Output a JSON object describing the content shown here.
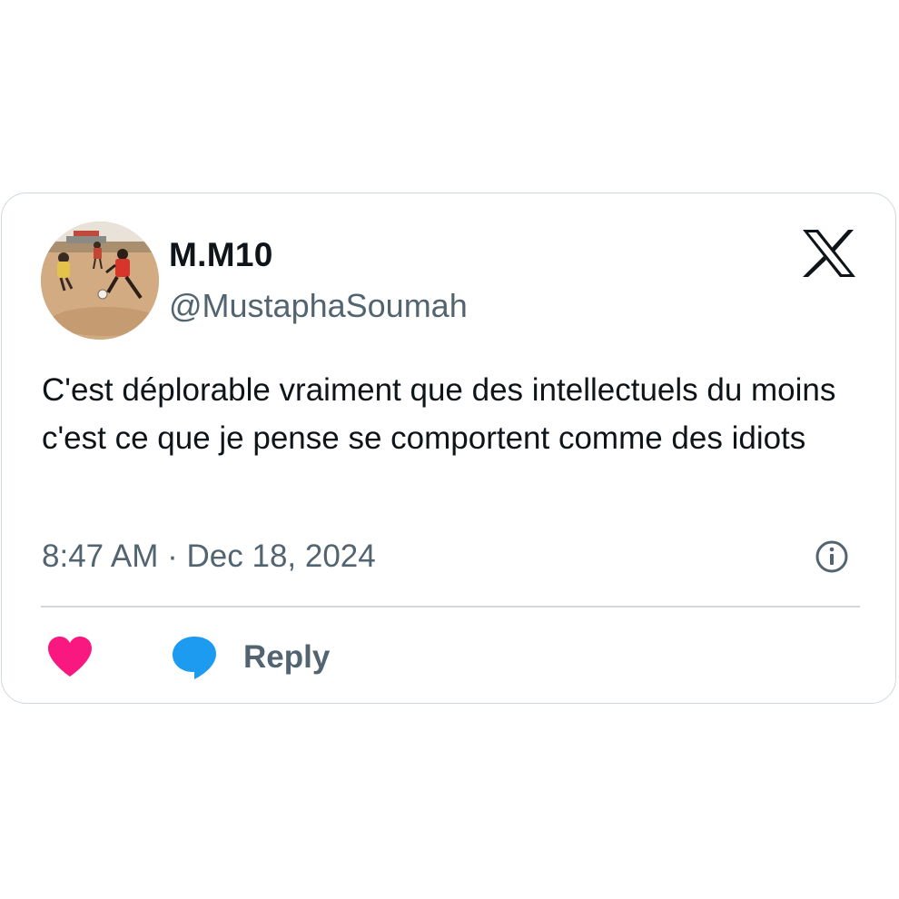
{
  "author": {
    "display_name": "M.M10",
    "handle": "@MustaphaSoumah",
    "avatar_icon": "avatar-photo-football-field"
  },
  "brand": {
    "logo_icon": "x-logo-icon"
  },
  "tweet": {
    "text": "C'est déplorable vraiment que des intellectuels du moins c'est ce que je pense se comportent comme des idiots",
    "timestamp": "8:47 AM · Dec 18, 2024"
  },
  "actions": {
    "like_icon": "heart-icon",
    "reply_icon": "speech-bubble-icon",
    "reply_label": "Reply",
    "info_icon": "info-icon"
  },
  "colors": {
    "text_primary": "#0f1419",
    "text_secondary": "#536471",
    "border": "#cfd9de",
    "like": "#f91880",
    "reply": "#1d9bf0"
  }
}
